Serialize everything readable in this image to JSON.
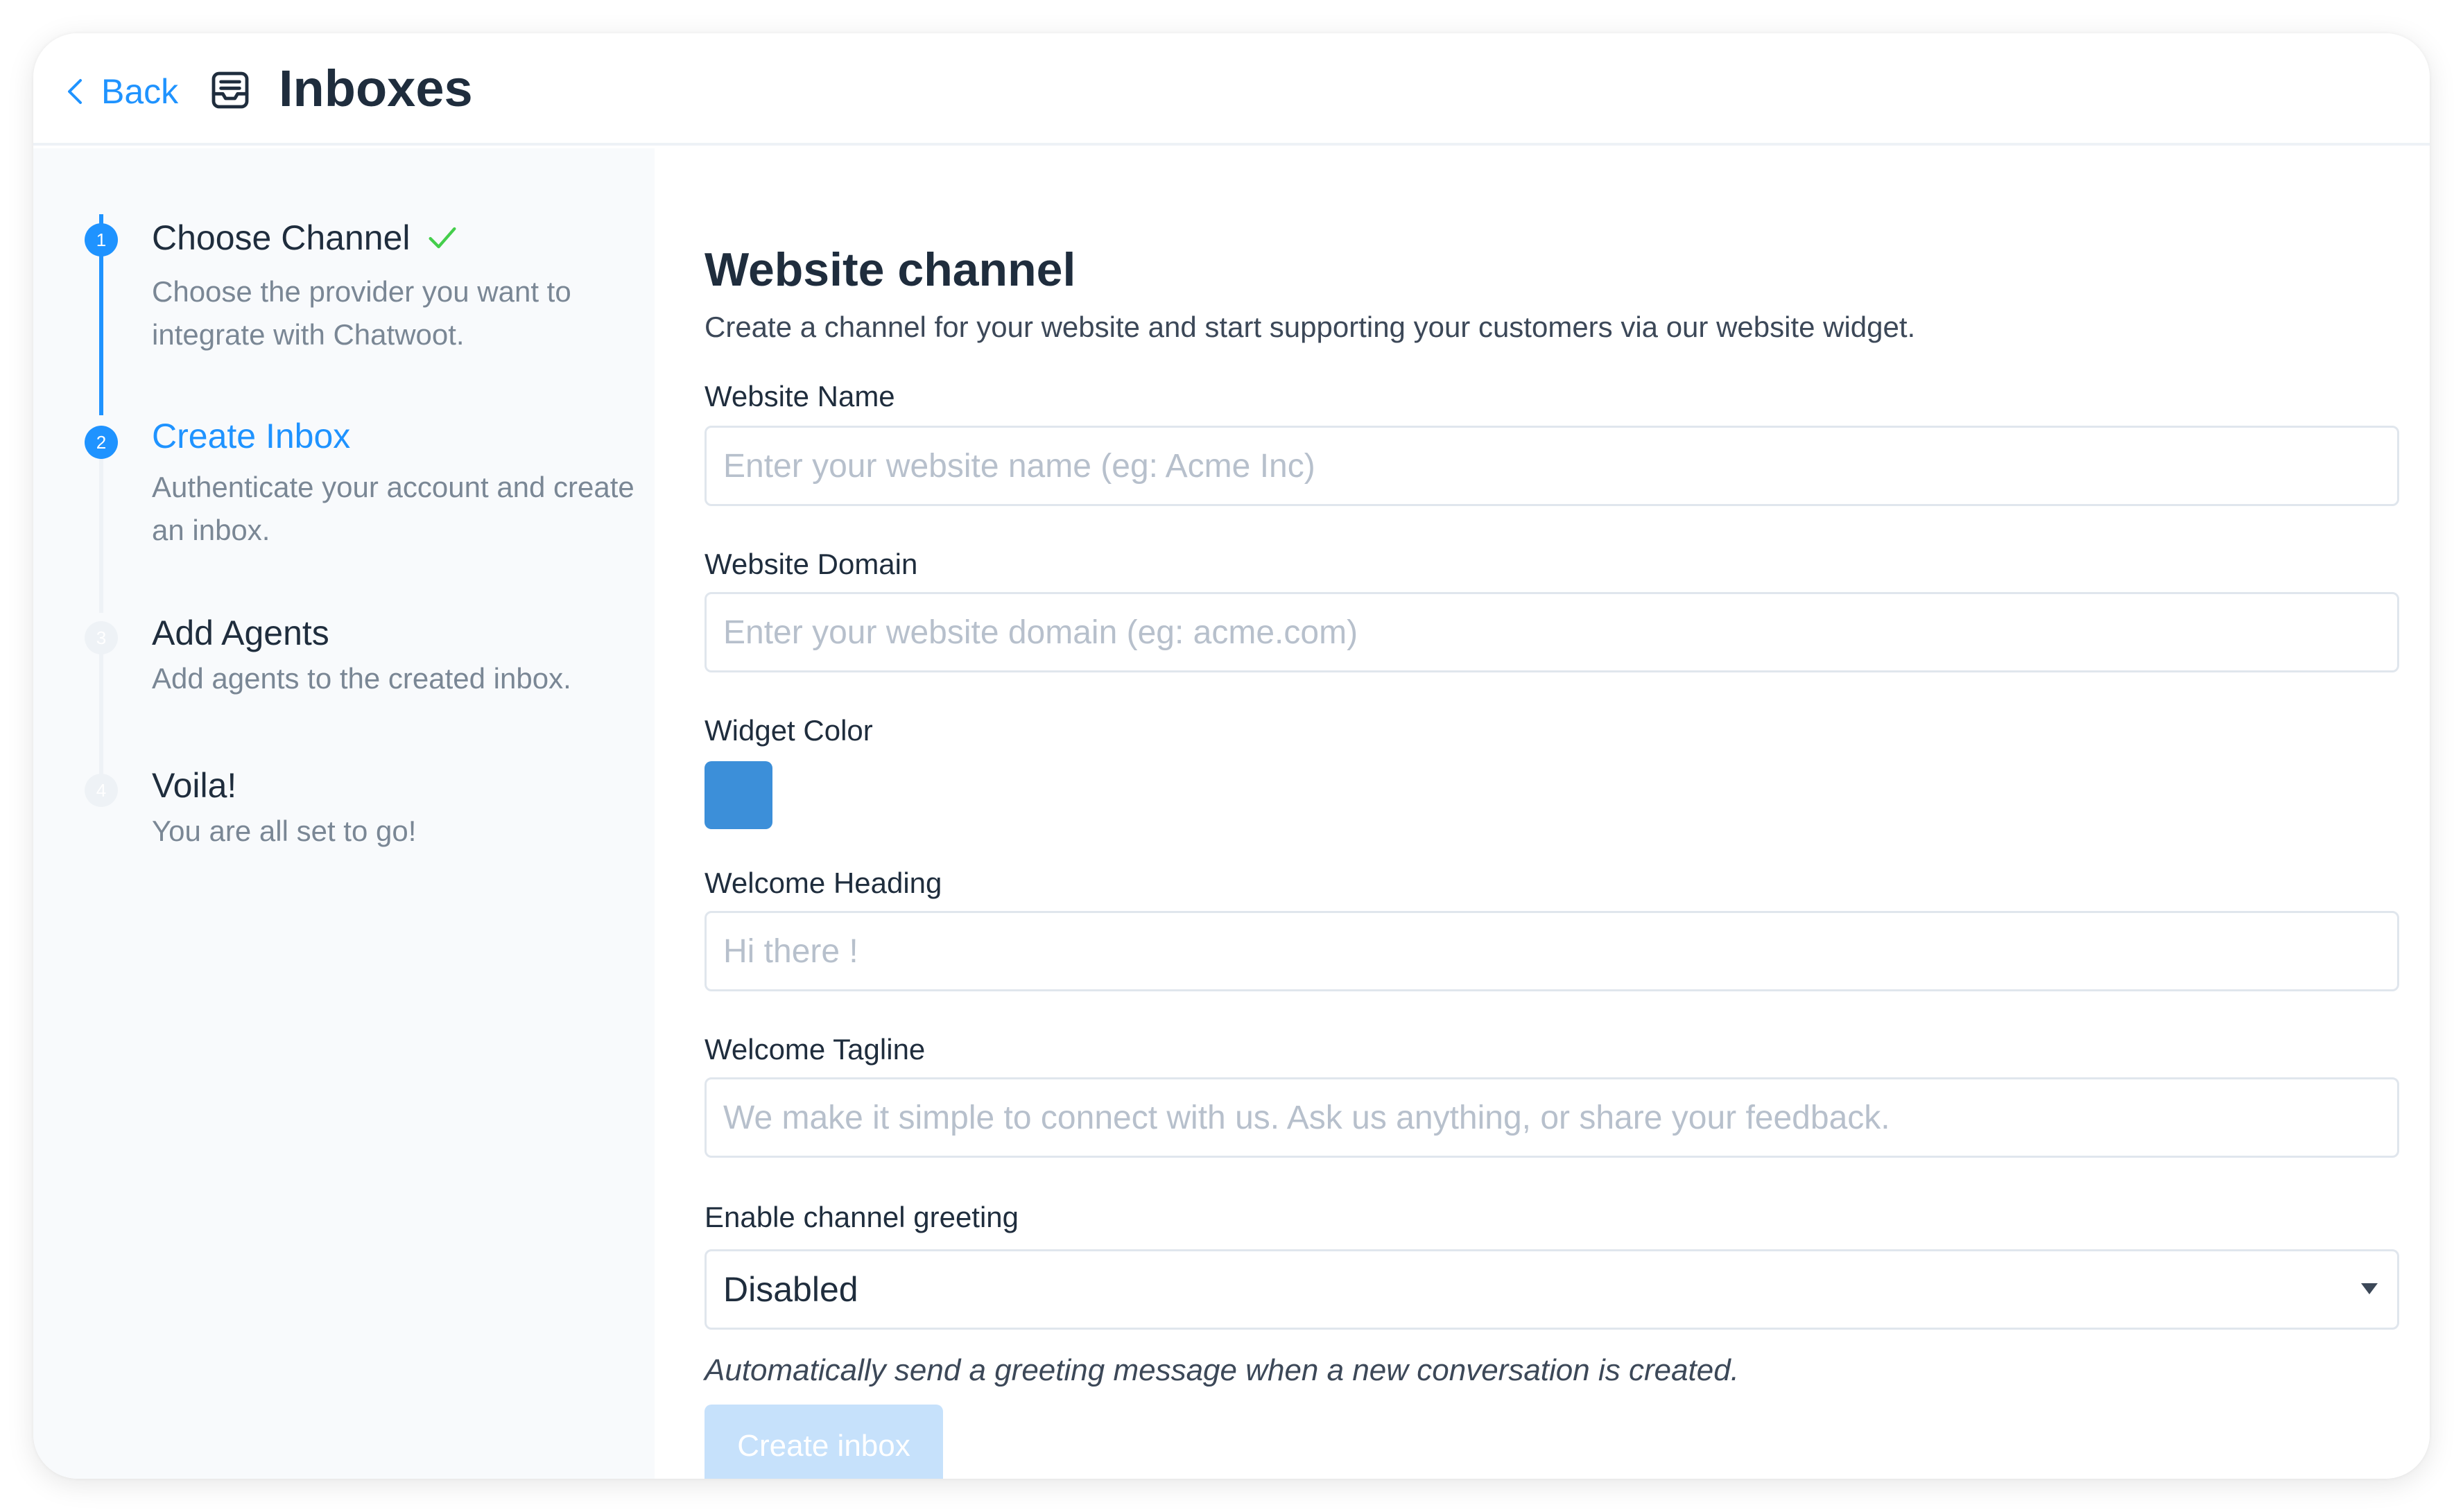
{
  "header": {
    "back_label": "Back",
    "title": "Inboxes",
    "icons": {
      "back": "chevron-left-icon",
      "inbox": "inbox-icon"
    }
  },
  "steps": [
    {
      "number": "1",
      "title": "Choose Channel",
      "description": "Choose the provider you want to integrate with Chatwoot.",
      "state": "completed"
    },
    {
      "number": "2",
      "title": "Create Inbox",
      "description": "Authenticate your account and create an inbox.",
      "state": "current"
    },
    {
      "number": "3",
      "title": "Add Agents",
      "description": "Add agents to the created inbox.",
      "state": "pending"
    },
    {
      "number": "4",
      "title": "Voila!",
      "description": "You are all set to go!",
      "state": "pending"
    }
  ],
  "form": {
    "heading": "Website channel",
    "subheading": "Create a channel for your website and start supporting your customers via our website widget.",
    "website_name": {
      "label": "Website Name",
      "placeholder": "Enter your website name (eg: Acme Inc)",
      "value": ""
    },
    "website_domain": {
      "label": "Website Domain",
      "placeholder": "Enter your website domain (eg: acme.com)",
      "value": ""
    },
    "widget_color": {
      "label": "Widget Color",
      "value": "#3C8FD9"
    },
    "welcome_heading": {
      "label": "Welcome Heading",
      "placeholder": "Hi there !",
      "value": ""
    },
    "welcome_tagline": {
      "label": "Welcome Tagline",
      "placeholder": "We make it simple to connect with us. Ask us anything, or share your feedback.",
      "value": ""
    },
    "channel_greeting": {
      "label": "Enable channel greeting",
      "selected": "Disabled",
      "help_text": "Automatically send a greeting message when a new conversation is created."
    },
    "submit_label": "Create inbox"
  },
  "colors": {
    "accent": "#1F93FF",
    "success": "#44CE4B",
    "button_disabled": "#C6E1FB"
  }
}
